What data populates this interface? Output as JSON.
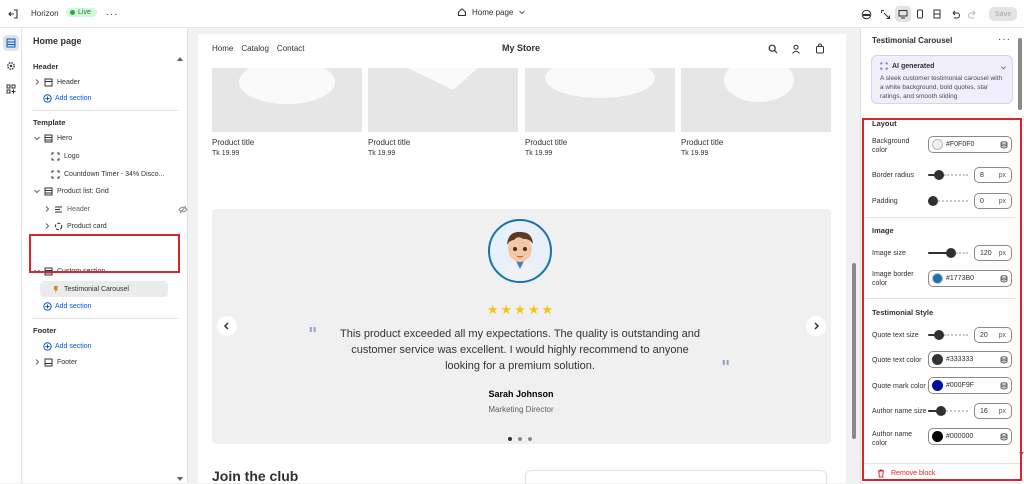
{
  "topbar": {
    "store_name": "Horizon",
    "live_label": "Live",
    "page_selector": "Home page",
    "save_label": "Save"
  },
  "left_panel": {
    "title": "Home page",
    "header_group": "Header",
    "header_item": "Header",
    "add_section": "Add section",
    "template_group": "Template",
    "hero": "Hero",
    "logo": "Logo",
    "countdown": "Countdown Timer - 34% Disco...",
    "product_list": "Product list: Grid",
    "pl_header": "Header",
    "product_card": "Product card",
    "custom_section": "Custom section",
    "testimonial": "Testimonial Carousel",
    "footer_group": "Footer",
    "footer_item": "Footer"
  },
  "preview": {
    "nav": [
      "Home",
      "Catalog",
      "Contact"
    ],
    "store_title": "My Store",
    "products": [
      {
        "title": "Product title",
        "price": "Tk 19.99"
      },
      {
        "title": "Product title",
        "price": "Tk 19.99"
      },
      {
        "title": "Product title",
        "price": "Tk 19.99"
      },
      {
        "title": "Product title",
        "price": "Tk 19.99"
      }
    ],
    "testimonial": {
      "rating": 5,
      "stars": "★★★★★",
      "quote_line1": "This product exceeded all my expectations. The quality is outstanding and",
      "quote_line2": "customer service was excellent. I would highly recommend to anyone",
      "quote_line3": "looking for a premium solution.",
      "author": "Sarah Johnson",
      "role": "Marketing Director",
      "open_quote_mark": "\"",
      "close_quote_mark": "\""
    },
    "join_title": "Join the club"
  },
  "right_panel": {
    "title": "Testimonial Carousel",
    "ai_label": "AI generated",
    "ai_desc": "A sleek customer testimonial carousel with a white background, bold quotes, star ratings, and smooth sliding",
    "layout_title": "Layout",
    "background_color_label": "Background color",
    "background_color": "#F0F0F0",
    "border_radius_label": "Border radius",
    "border_radius": "8",
    "padding_label": "Padding",
    "padding": "0",
    "image_title": "Image",
    "image_size_label": "Image size",
    "image_size": "120",
    "image_border_color_label": "Image border color",
    "image_border_color": "#1773B0",
    "style_title": "Testimonial Style",
    "quote_text_size_label": "Quote text size",
    "quote_text_size": "20",
    "quote_text_color_label": "Quote text color",
    "quote_text_color": "#333333",
    "quote_mark_color_label": "Quote mark color",
    "quote_mark_color": "#000F9F",
    "author_name_size_label": "Author name size",
    "author_name_size": "16",
    "author_name_color_label": "Author name color",
    "author_name_color": "#000000",
    "px": "px",
    "remove_block": "Remove block"
  },
  "colors": {
    "accent_blue": "#005bd3",
    "highlight_red": "#d9262a",
    "star_yellow": "#f5c518",
    "quote_mark": "#8fa3c9"
  },
  "slider_levels": {
    "border_radius": 0.2,
    "padding": 0.0,
    "image_size": 0.6,
    "quote_text_size": 0.2,
    "author_name_size": 0.28
  }
}
